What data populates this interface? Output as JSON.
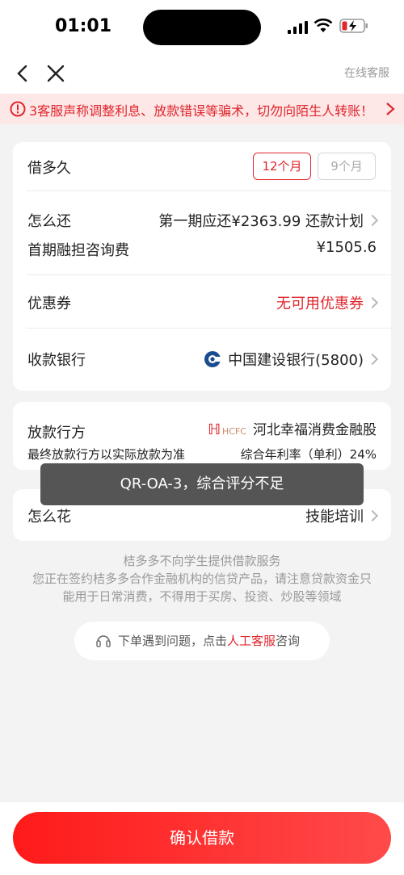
{
  "status": {
    "time": "01:01"
  },
  "nav": {
    "service": "在线客服"
  },
  "warning": {
    "text": "3客服声称调整利息、放款错误等骗术，切勿向陌生人转账！"
  },
  "loan": {
    "term_label": "借多久",
    "terms": [
      "12个月",
      "9个月"
    ],
    "repay_label": "怎么还",
    "repay_value": "第一期应还¥2363.99 还款计划",
    "fee_label": "首期融担咨询费",
    "fee_value": "¥1505.6",
    "coupon_label": "优惠券",
    "coupon_value": "无可用优惠券",
    "bank_label": "收款银行",
    "bank_value": "中国建设银行(5800)"
  },
  "lender": {
    "label": "放款行方",
    "logo_text": "HCFC",
    "name": "河北幸福消费金融股",
    "note": "最终放款行方以实际放款为准",
    "rate": "综合年利率（单利）24%"
  },
  "usage": {
    "label": "怎么花",
    "value": "技能培训"
  },
  "toast": "QR-OA-3，综合评分不足",
  "notices": {
    "line1": "桔多多不向学生提供借款服务",
    "line2": "您正在签约桔多多合作金融机构的信贷产品，请注意贷款资金只",
    "line3": "能用于日常消费，不得用于买房、投资、炒股等领域"
  },
  "help": {
    "prefix": "下单遇到问题，点击",
    "link": "人工客服",
    "suffix": "咨询"
  },
  "confirm_button": "确认借款",
  "colors": {
    "accent": "#e0262c",
    "background": "#f3f3f3"
  }
}
